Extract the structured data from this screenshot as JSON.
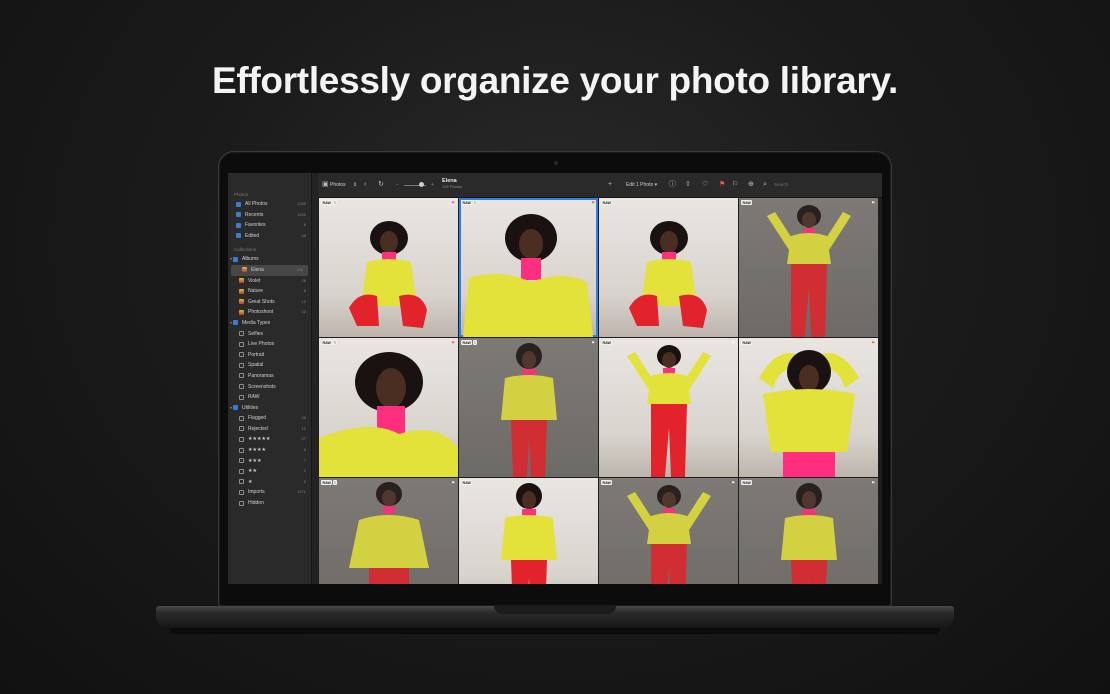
{
  "headline": "Effortlessly organize your photo library.",
  "sidebar": {
    "photos_title": "Photos",
    "library_items": [
      {
        "label": "All Photos",
        "count": "1250"
      },
      {
        "label": "Recents",
        "count": "1250"
      },
      {
        "label": "Favorites",
        "count": "8"
      },
      {
        "label": "Edited",
        "count": "48"
      }
    ],
    "collections_title": "Collections",
    "albums_label": "Albums",
    "albums": [
      {
        "label": "Elena",
        "count": "128"
      },
      {
        "label": "Violet",
        "count": "28"
      },
      {
        "label": "Nature",
        "count": "8"
      },
      {
        "label": "Great Shots",
        "count": "12"
      },
      {
        "label": "Photoshoot",
        "count": "22"
      }
    ],
    "media_types_label": "Media Types",
    "media_types": [
      {
        "label": "Selfies"
      },
      {
        "label": "Live Photos"
      },
      {
        "label": "Portrait"
      },
      {
        "label": "Spatial"
      },
      {
        "label": "Panoramas"
      },
      {
        "label": "Screenshots"
      },
      {
        "label": "RAW"
      }
    ],
    "utilities_label": "Utilities",
    "utilities": [
      {
        "label": "Flagged",
        "count": "28"
      },
      {
        "label": "Rejected",
        "count": "12"
      },
      {
        "label": "★★★★★",
        "count": "37"
      },
      {
        "label": "★★★★",
        "count": "8"
      },
      {
        "label": "★★★",
        "count": "7"
      },
      {
        "label": "★★",
        "count": "2"
      },
      {
        "label": "★",
        "count": "5"
      },
      {
        "label": "Imports",
        "count": "1271"
      },
      {
        "label": "Hidden",
        "count": ""
      }
    ]
  },
  "toolbar": {
    "library_select": "Photos",
    "album_title": "Elena",
    "album_subtitle": "128 Photos",
    "edit_menu": "Edit 1 Photo",
    "search_placeholder": "Search",
    "icons": {
      "back": "‹",
      "rotate": "↻",
      "minus": "−",
      "plus": "+",
      "add": "+",
      "info": "ⓘ",
      "share": "⇧",
      "heart": "♡",
      "flag": "⚑",
      "flag_outline": "⚐",
      "more": "⊕",
      "search": "⌕"
    }
  },
  "photos": [
    {
      "raw": "RAW",
      "linked": true,
      "flag": "red",
      "bg": "light",
      "pose": "squat"
    },
    {
      "raw": "RAW",
      "linked": true,
      "flag": "red",
      "bg": "light",
      "pose": "seated",
      "selected": true
    },
    {
      "raw": "RAW",
      "linked": false,
      "flag": "",
      "bg": "light",
      "pose": "squat"
    },
    {
      "raw": "RAW",
      "linked": false,
      "flag": "white",
      "bg": "gray",
      "pose": "arms-up"
    },
    {
      "raw": "RAW",
      "linked": true,
      "flag": "red",
      "bg": "light",
      "pose": "closeup"
    },
    {
      "raw": "RAW",
      "linked": true,
      "flag": "white",
      "bg": "gray",
      "pose": "standing"
    },
    {
      "raw": "RAW",
      "linked": false,
      "flag": "white",
      "bg": "light",
      "pose": "arms-up"
    },
    {
      "raw": "RAW",
      "linked": false,
      "flag": "red",
      "bg": "light",
      "pose": "closeup-arms"
    },
    {
      "raw": "RAW",
      "linked": true,
      "flag": "white",
      "bg": "gray",
      "pose": "hands-hips"
    },
    {
      "raw": "RAW",
      "linked": false,
      "flag": "",
      "bg": "light",
      "pose": "standing"
    },
    {
      "raw": "RAW",
      "linked": false,
      "flag": "white",
      "bg": "gray",
      "pose": "arms-up"
    },
    {
      "raw": "RAW",
      "linked": false,
      "flag": "white",
      "bg": "gray",
      "pose": "standing"
    }
  ]
}
